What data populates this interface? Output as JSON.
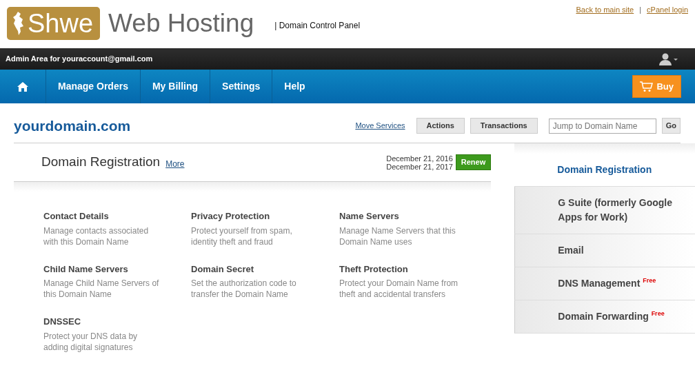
{
  "logo": {
    "mark": "Shwe",
    "name": "Web Hosting"
  },
  "tagline": "| Domain Control Panel",
  "top_links": [
    {
      "label": "Back to main site"
    },
    {
      "label": "cPanel login"
    }
  ],
  "top_link_separator": "|",
  "admin_bar": {
    "text": "Admin Area for youraccount@gmail.com"
  },
  "nav": {
    "items": [
      "Manage Orders",
      "My Billing",
      "Settings",
      "Help"
    ],
    "buy": "Buy"
  },
  "domain": {
    "name": "yourdomain.com",
    "move_link": "Move Services",
    "buttons": [
      "Actions",
      "Transactions"
    ],
    "jump": {
      "placeholder": "Jump to Domain Name"
    },
    "go": "Go"
  },
  "section": {
    "title": "Domain Registration",
    "more": "More",
    "dates": [
      "December 21, 2016",
      "December 21, 2017"
    ],
    "renew": "Renew"
  },
  "features": [
    {
      "title": "Contact Details",
      "desc": "Manage contacts associated with this Domain Name"
    },
    {
      "title": "Privacy Protection",
      "desc": "Protect yourself from spam, identity theft and fraud"
    },
    {
      "title": "Name Servers",
      "desc": "Manage Name Servers that this Domain Name uses"
    },
    {
      "title": "Child Name Servers",
      "desc": "Manage Child Name Servers of this Domain Name"
    },
    {
      "title": "Domain Secret",
      "desc": "Set the authorization code to transfer the Domain Name"
    },
    {
      "title": "Theft Protection",
      "desc": "Protect your Domain Name from theft and accidental transfers"
    },
    {
      "title": "DNSSEC",
      "desc": "Protect your DNS data by adding digital signatures"
    }
  ],
  "sidebar": {
    "items": [
      {
        "label": "Domain Registration",
        "selected": true
      },
      {
        "label": "G Suite (formerly Google Apps for Work)",
        "selected": false
      },
      {
        "label": "Email",
        "selected": false
      },
      {
        "label": "DNS Management",
        "badge": "Free",
        "selected": false
      },
      {
        "label": "Domain Forwarding",
        "badge": "Free",
        "selected": false
      }
    ]
  }
}
